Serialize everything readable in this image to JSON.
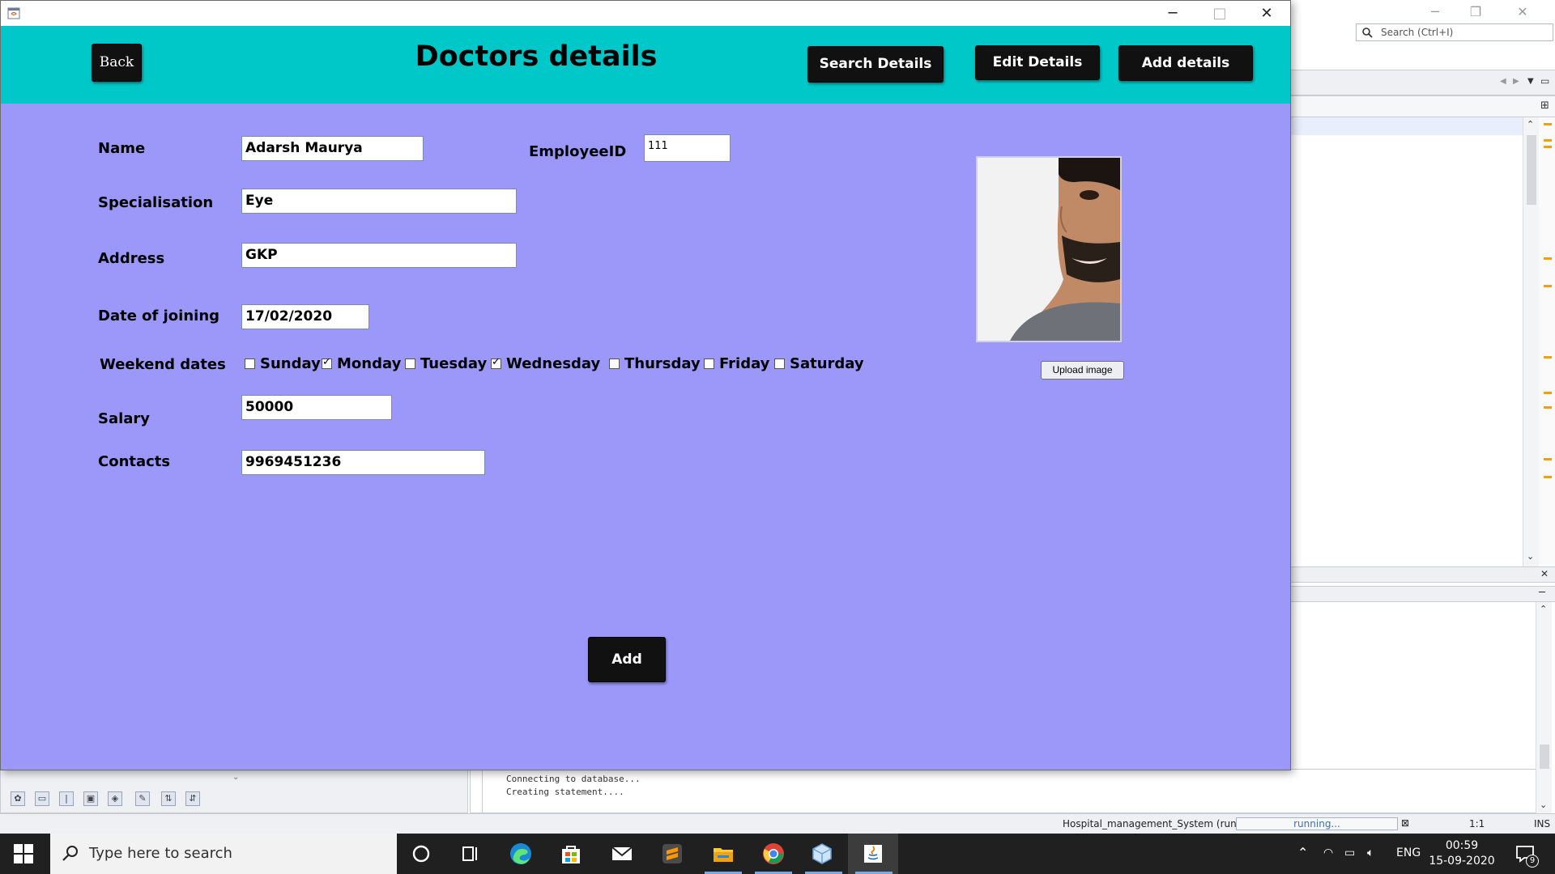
{
  "ide": {
    "search_placeholder": "Search (Ctrl+I)",
    "output_lines": "Connecting to database...\nCreating statement....",
    "status_project": "Hospital_management_System (run)",
    "status_progress": "running...",
    "status_position": "1:1",
    "status_mode": "INS"
  },
  "window": {
    "title": "",
    "minimize": "─",
    "maximize": "□",
    "close": "✕"
  },
  "header": {
    "back_label": "Back",
    "title": "Doctors details",
    "search_label": "Search Details",
    "edit_label": "Edit Details",
    "add_details_label": "Add details"
  },
  "form": {
    "name_label": "Name",
    "name_value": "Adarsh Maurya",
    "employee_id_label": "EmployeeID",
    "employee_id_value": "111",
    "specialisation_label": "Specialisation",
    "specialisation_value": "Eye",
    "address_label": "Address",
    "address_value": "GKP",
    "doj_label": "Date of joining",
    "doj_value": "17/02/2020",
    "weekend_label": "Weekend dates",
    "weekend_days": [
      {
        "label": "Sunday",
        "checked": false
      },
      {
        "label": "Monday",
        "checked": true
      },
      {
        "label": "Tuesday",
        "checked": false
      },
      {
        "label": "Wednesday",
        "checked": true
      },
      {
        "label": "Thursday",
        "checked": false
      },
      {
        "label": "Friday",
        "checked": false
      },
      {
        "label": "Saturday",
        "checked": false
      }
    ],
    "salary_label": "Salary",
    "salary_value": "50000",
    "contacts_label": "Contacts",
    "contacts_value": "9969451236",
    "upload_label": "Upload image",
    "add_label": "Add"
  },
  "taskbar": {
    "search_placeholder": "Type here to search",
    "lang": "ENG",
    "time": "00:59",
    "date": "15-09-2020",
    "notification_count": "9"
  },
  "colors": {
    "form_bg": "#9b98fa",
    "header_bg": "#00c8c8",
    "button_dark": "#111111"
  }
}
